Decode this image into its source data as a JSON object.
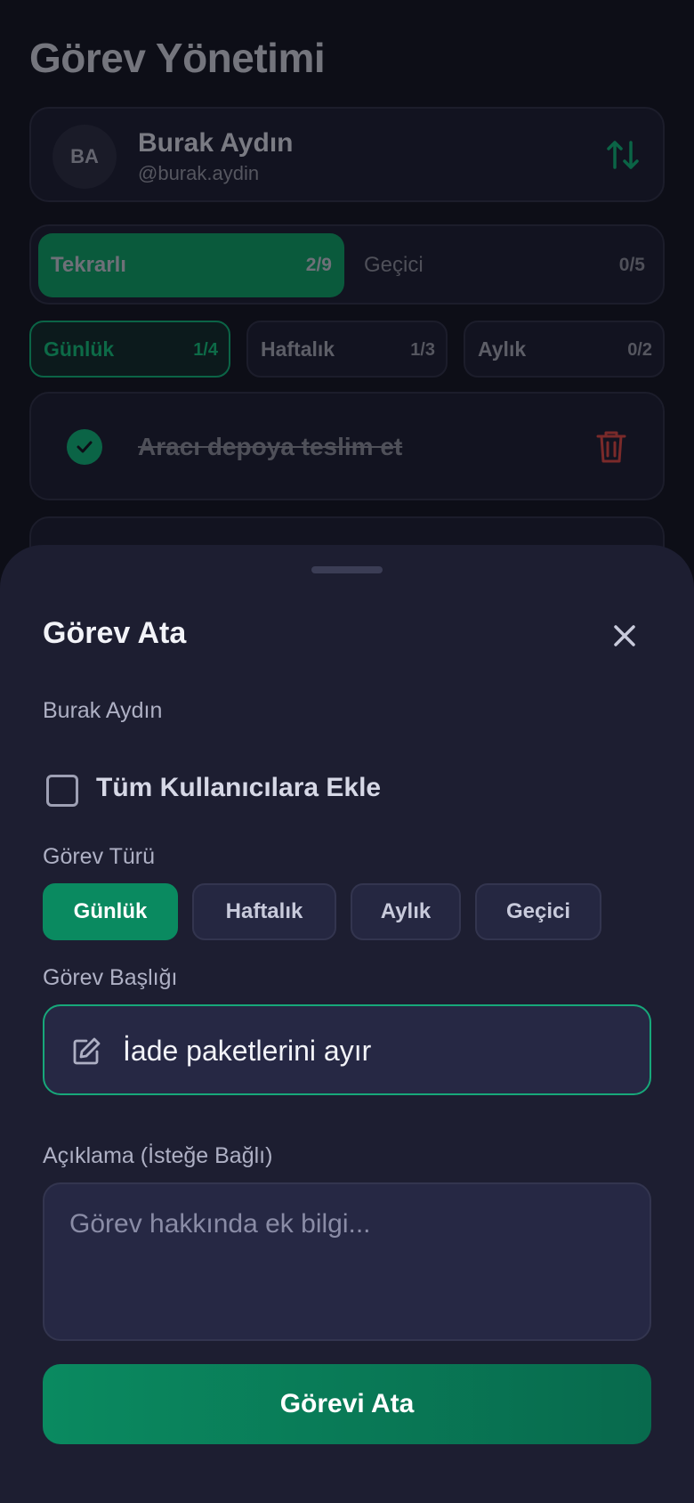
{
  "page": {
    "title": "Görev Yönetimi"
  },
  "user": {
    "initials": "BA",
    "name": "Burak Aydın",
    "handle": "@burak.aydin"
  },
  "segments": [
    {
      "label": "Tekrarlı",
      "count": "2/9",
      "active": true
    },
    {
      "label": "Geçici",
      "count": "0/5",
      "active": false
    }
  ],
  "period_tabs": [
    {
      "label": "Günlük",
      "count": "1/4",
      "active": true
    },
    {
      "label": "Haftalık",
      "count": "1/3",
      "active": false
    },
    {
      "label": "Aylık",
      "count": "0/2",
      "active": false
    }
  ],
  "tasks": [
    {
      "title": "Aracı depoya teslim et",
      "completed": true
    }
  ],
  "sheet": {
    "title": "Görev Ata",
    "assignee": "Burak Aydın",
    "all_users_label": "Tüm Kullanıcılara Ekle",
    "all_users_checked": false,
    "type_label": "Görev Türü",
    "types": [
      {
        "label": "Günlük",
        "active": true
      },
      {
        "label": "Haftalık",
        "active": false
      },
      {
        "label": "Aylık",
        "active": false
      },
      {
        "label": "Geçici",
        "active": false
      }
    ],
    "title_label": "Görev Başlığı",
    "title_value": "İade paketlerini ayır",
    "description_label": "Açıklama (İsteğe Bağlı)",
    "description_placeholder": "Görev hakkında ek bilgi...",
    "submit_label": "Görevi Ata"
  },
  "colors": {
    "accent": "#0a8a60",
    "danger": "#c0392b",
    "sheet_bg": "#1d1e31"
  },
  "icons": {
    "sort": "sort-arrows-icon",
    "check": "check-icon",
    "trash": "trash-icon",
    "close": "close-icon",
    "edit": "edit-icon"
  }
}
